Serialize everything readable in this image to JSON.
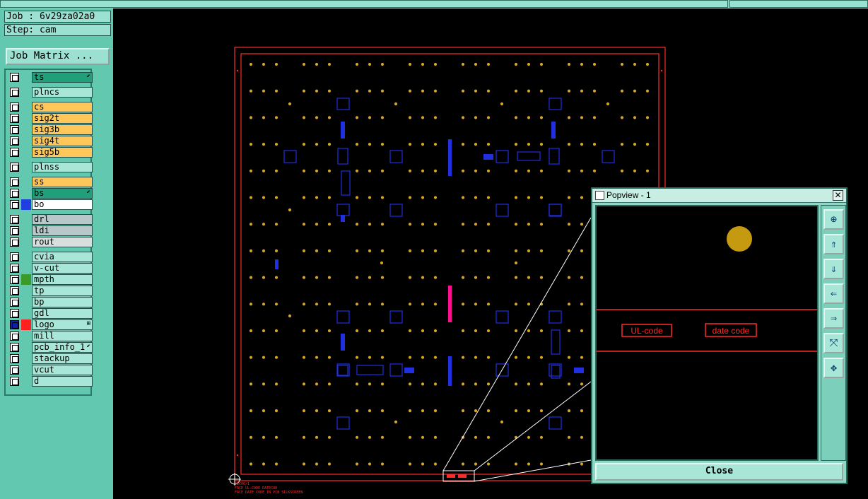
{
  "job": {
    "label": "Job : 6v29za02a0",
    "step": "Step: cam"
  },
  "matrix_button": "Job Matrix ...",
  "layers": [
    {
      "name": "ts",
      "bg": "#1fa07a",
      "mark": "⬋"
    },
    {
      "name": "plncs",
      "bg": "#a8e6d8"
    },
    {
      "name": "cs",
      "bg": "#ffc75a"
    },
    {
      "name": "sig2t",
      "bg": "#ffc75a"
    },
    {
      "name": "sig3b",
      "bg": "#ffc75a"
    },
    {
      "name": "sig4t",
      "bg": "#ffc75a"
    },
    {
      "name": "sig5b",
      "bg": "#ffc75a"
    },
    {
      "name": "plnss",
      "bg": "#a8e6d8"
    },
    {
      "name": "ss",
      "bg": "#ffc75a"
    },
    {
      "name": "bs",
      "bg": "#1fa07a",
      "mark": "⬋"
    },
    {
      "name": "bo",
      "bg": "#ffffff",
      "swatch": "#1f3fe0"
    },
    {
      "name": "drl",
      "bg": "#b8c8c8"
    },
    {
      "name": "ldi",
      "bg": "#b8c8c8"
    },
    {
      "name": "rout",
      "bg": "#d8dede"
    },
    {
      "name": "cvia",
      "bg": "#a8e6d8"
    },
    {
      "name": "v-cut",
      "bg": "#a8e6d8"
    },
    {
      "name": "mpth",
      "bg": "#a8e6d8",
      "swatch": "#3a9a2a"
    },
    {
      "name": "tp",
      "bg": "#a8e6d8"
    },
    {
      "name": "bp",
      "bg": "#a8e6d8"
    },
    {
      "name": "gdl",
      "bg": "#a8e6d8"
    },
    {
      "name": "logo",
      "bg": "#a8e6d8",
      "swatch": "#ff2020",
      "mark": "⊞",
      "chk_color": "#1020a0"
    },
    {
      "name": "mill",
      "bg": "#a8e6d8"
    },
    {
      "name": "pcb_info_1",
      "bg": "#a8e6d8",
      "mark": "⬋"
    },
    {
      "name": "stackup",
      "bg": "#a8e6d8"
    },
    {
      "name": "vcut",
      "bg": "#a8e6d8"
    },
    {
      "name": "d",
      "bg": "#a8e6d8"
    }
  ],
  "board": {
    "id_text": "SDC06/1",
    "bottom_text1": "FACE UL-CODE DATECOD",
    "bottom_text2": "FACE DATE CODE IN PCB SILKSCREEN"
  },
  "popup": {
    "title": "Popview - 1",
    "labels": [
      "UL-code",
      "date code"
    ],
    "close_label": "Close",
    "tools": [
      "zoom-in-icon",
      "pan-up-icon",
      "pan-down-icon",
      "pan-left-icon",
      "pan-right-icon",
      "fit-icon",
      "center-icon"
    ]
  },
  "colors": {
    "board_outline": "#ff2a2a",
    "pad": "#d6a521",
    "component": "#2030e0",
    "highlight": "#ff1090"
  }
}
